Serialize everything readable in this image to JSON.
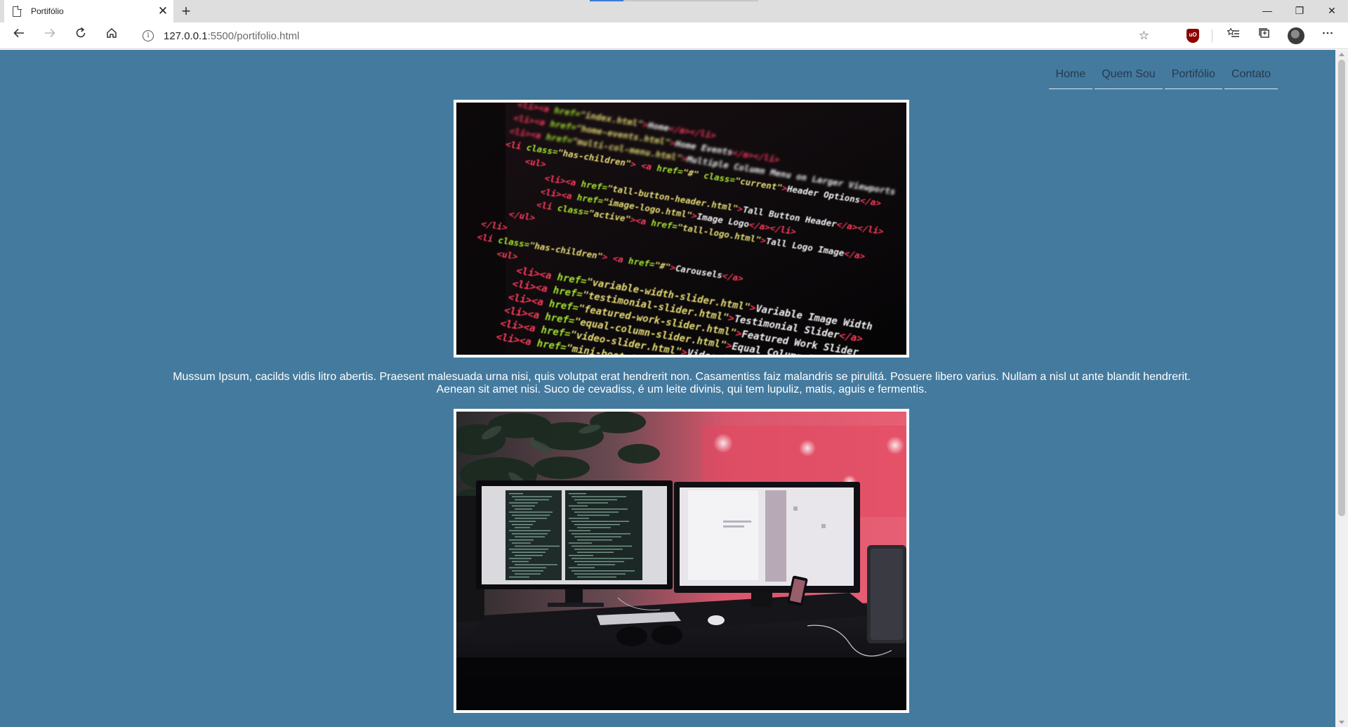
{
  "browser": {
    "tab_title": "Portifólio",
    "tab_close": "✕",
    "new_tab": "+",
    "url_host": "127.0.0.1",
    "url_path": ":5500/portifolio.html",
    "controls": {
      "minimize": "—",
      "restore": "❐",
      "close": "✕"
    },
    "toolbar_icons": [
      "back-icon",
      "forward-icon",
      "refresh-icon",
      "home-icon",
      "site-info-icon",
      "favorite-star-icon",
      "ublock-icon",
      "favorites-icon",
      "collections-icon",
      "profile-avatar",
      "more-icon"
    ]
  },
  "nav": {
    "items": [
      {
        "label": "Home"
      },
      {
        "label": "Quem Sou"
      },
      {
        "label": "Portifólio"
      },
      {
        "label": "Contato"
      }
    ]
  },
  "content": {
    "paragraph_line1": "Mussum Ipsum, cacilds vidis litro abertis. Praesent malesuada urna nisi, quis volutpat erat hendrerit non. Casamentiss faiz malandris se pirulitá. Posuere libero varius. Nullam a nisl ut ante blandit hendrerit.",
    "paragraph_line2": "Aenean sit amet nisi. Suco de cevadiss, é um leite divinis, qui tem lupuliz, matis, aguis e fermentis."
  },
  "code_photo": {
    "lines": [
      "<li><a href=\"index.html\">Home</a></li>",
      "<li><a href=\"home-events.html\">Home Events</a></li>",
      "<li><a href=\"multi-col-menu.html\">Multiple Column Menu on Larger Viewports",
      "<li class=\"has-children\"> <a href=\"#\" class=\"current\">Header Options</a>",
      "<ul>",
      "<li><a href=\"tall-button-header.html\">Tall Button Header</a></li>",
      "<li><a href=\"image-logo.html\">Image Logo</a></li>",
      "<li class=\"active\"><a href=\"tall-logo.html\">Tall Logo Image</a>",
      "</ul>",
      "</li>",
      "<li class=\"has-children\"> <a href=\"#\">Carousels</a>",
      "<ul>",
      "<li><a href=\"variable-width-slider.html\">Variable Image Width",
      "<li><a href=\"testimonial-slider.html\">Testimonial Slider</a>",
      "<li><a href=\"featured-work-slider.html\">Featured Work Slider",
      "<li><a href=\"equal-column-slider.html\">Equal Column Slider",
      "<li><a href=\"video-slider.html\">Video Slider</a></li>",
      "<li><a href=\"mini-bootstrap-carousel.html\">Mini Slider</a>"
    ]
  }
}
